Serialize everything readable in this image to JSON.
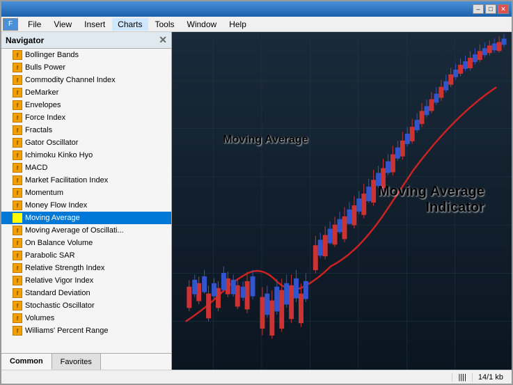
{
  "window": {
    "title": ""
  },
  "title_buttons": {
    "minimize": "–",
    "maximize": "□",
    "close": "✕"
  },
  "menu": {
    "icon": "F",
    "items": [
      "File",
      "View",
      "Insert",
      "Charts",
      "Tools",
      "Window",
      "Help"
    ]
  },
  "navigator": {
    "title": "Navigator",
    "close": "✕",
    "items": [
      {
        "label": "Bollinger Bands"
      },
      {
        "label": "Bulls Power"
      },
      {
        "label": "Commodity Channel Index"
      },
      {
        "label": "DeMarker"
      },
      {
        "label": "Envelopes"
      },
      {
        "label": "Force Index"
      },
      {
        "label": "Fractals"
      },
      {
        "label": "Gator Oscillator"
      },
      {
        "label": "Ichimoku Kinko Hyo"
      },
      {
        "label": "MACD"
      },
      {
        "label": "Market Facilitation Index"
      },
      {
        "label": "Momentum"
      },
      {
        "label": "Money Flow Index"
      },
      {
        "label": "Moving Average",
        "selected": true
      },
      {
        "label": "Moving Average of Oscillati..."
      },
      {
        "label": "On Balance Volume"
      },
      {
        "label": "Parabolic SAR"
      },
      {
        "label": "Relative Strength Index"
      },
      {
        "label": "Relative Vigor Index"
      },
      {
        "label": "Standard Deviation"
      },
      {
        "label": "Stochastic Oscillator"
      },
      {
        "label": "Volumes"
      },
      {
        "label": "Williams' Percent Range"
      }
    ],
    "tabs": [
      {
        "label": "Common",
        "active": true
      },
      {
        "label": "Favorites"
      }
    ]
  },
  "chart": {
    "label_ma": "Moving Average",
    "label_indicator_line1": "Moving Average",
    "label_indicator_line2": "Indicator"
  },
  "status_bar": {
    "bars_icon": "||||",
    "size": "14/1 kb"
  }
}
